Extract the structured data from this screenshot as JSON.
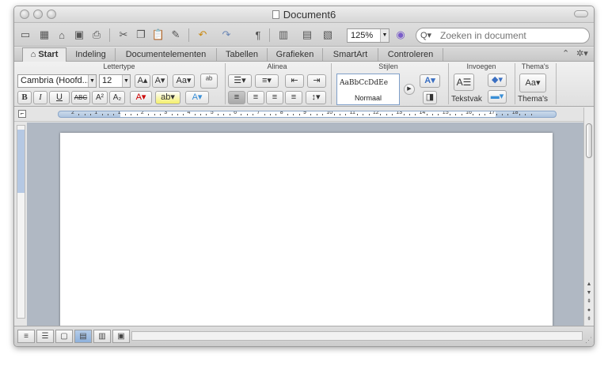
{
  "window": {
    "title": "Document6"
  },
  "toolbar": {
    "zoom_value": "125%",
    "search_placeholder": "Zoeken in document",
    "icons": [
      "new-document-icon",
      "templates-icon",
      "open-icon",
      "save-icon",
      "print-icon",
      "cut-icon",
      "copy-icon",
      "paste-icon",
      "format-painter-icon",
      "undo-icon",
      "redo-icon",
      "pilcrow-icon",
      "sidebar-icon",
      "toolbox-icon",
      "media-browser-icon",
      "help-icon"
    ]
  },
  "ribbon_tabs": [
    {
      "label": "Start",
      "active": true
    },
    {
      "label": "Indeling"
    },
    {
      "label": "Documentelementen"
    },
    {
      "label": "Tabellen"
    },
    {
      "label": "Grafieken"
    },
    {
      "label": "SmartArt"
    },
    {
      "label": "Controleren"
    }
  ],
  "groups": {
    "font": {
      "title": "Lettertype",
      "font_name": "Cambria (Hoofd...",
      "font_size": "12",
      "bold": "B",
      "italic": "I",
      "underline": "U",
      "strike": "ABC",
      "superscript": "A²",
      "subscript": "A₂"
    },
    "paragraph": {
      "title": "Alinea"
    },
    "styles": {
      "title": "Stijlen",
      "sample_text": "AaBbCcDdEe",
      "style_name": "Normaal"
    },
    "insert": {
      "title": "Invoegen",
      "textbox_label": "Tekstvak"
    },
    "themes": {
      "title": "Thema's",
      "button_label": "Thema's"
    }
  },
  "ruler": {
    "numbers": [
      "2",
      "1",
      "1",
      "2",
      "3",
      "4",
      "5",
      "6",
      "7",
      "8",
      "9",
      "10",
      "11",
      "12",
      "13",
      "14",
      "15",
      "16",
      "17",
      "18"
    ]
  },
  "status": {
    "views": [
      "draft-view",
      "outline-view",
      "publishing-view",
      "print-layout-view",
      "notebook-view",
      "full-screen-view"
    ],
    "active_view": "print-layout-view"
  }
}
